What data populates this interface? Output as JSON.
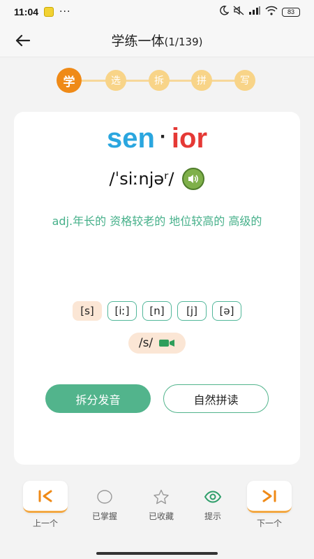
{
  "status_bar": {
    "time": "11:04",
    "dots": "···",
    "battery": "83"
  },
  "header": {
    "title": "学练一体",
    "count": "(1/139)"
  },
  "steps": [
    {
      "label": "学",
      "active": true
    },
    {
      "label": "选",
      "active": false
    },
    {
      "label": "拆",
      "active": false
    },
    {
      "label": "拼",
      "active": false
    },
    {
      "label": "写",
      "active": false
    }
  ],
  "card": {
    "word_part1": "sen",
    "word_separator": "·",
    "word_part2": "ior",
    "phonetic": "/ˈsiːnjəʳ/",
    "definition": "adj.年长的 资格较老的 地位较高的 高级的",
    "phonemes": [
      "[s]",
      "[iː]",
      "[n]",
      "[j]",
      "[ə]"
    ],
    "active_phoneme": 0,
    "current_sound": "/s/",
    "split_button": "拆分发音",
    "phonics_button": "自然拼读"
  },
  "toolbar": {
    "prev_label": "上一个",
    "mastered_label": "已掌握",
    "favorite_label": "已收藏",
    "hint_label": "提示",
    "next_label": "下一个"
  },
  "colors": {
    "accent_orange": "#ef8a17",
    "step_light": "#f8d488",
    "green": "#52b48c",
    "word_blue": "#2aa6df",
    "word_red": "#e53935"
  }
}
